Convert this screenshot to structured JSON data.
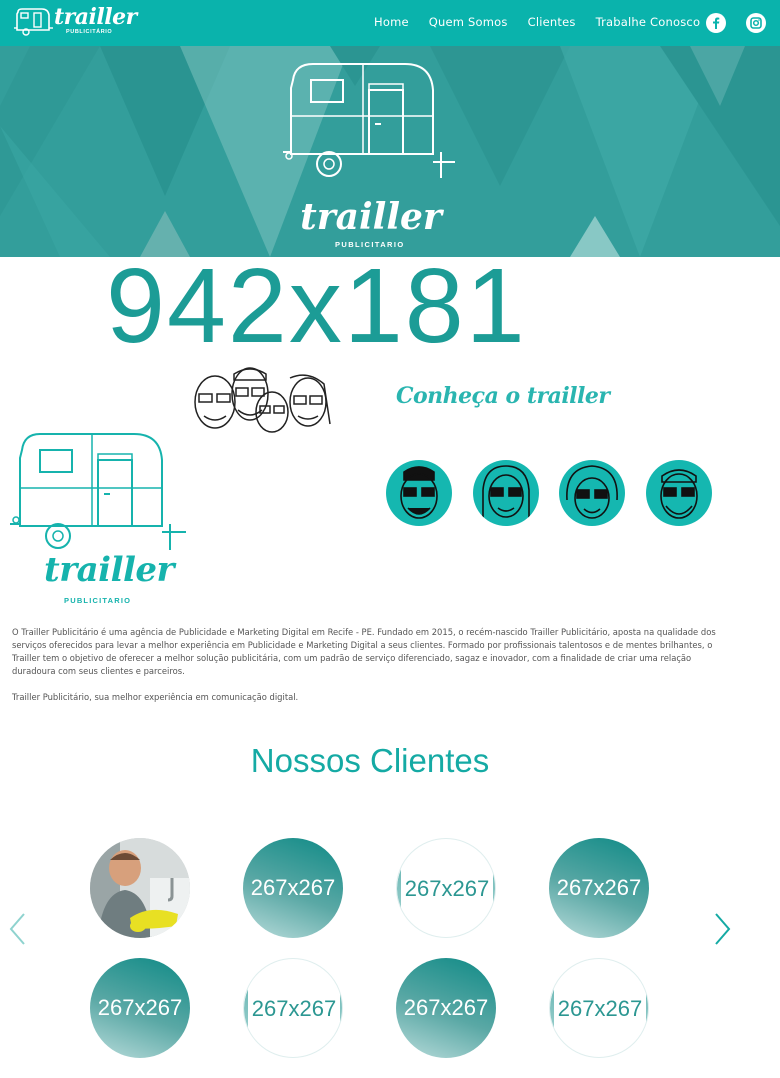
{
  "nav": {
    "brand": "trailler",
    "brand_sub": "PUBLICITÁRIO",
    "links": [
      "Home",
      "Quem Somos",
      "Clientes",
      "Trabalhe Conosco"
    ],
    "social": [
      "facebook-icon",
      "instagram-icon"
    ]
  },
  "hero": {
    "logo_word": "trailler",
    "logo_sub": "PUBLICITARIO"
  },
  "banner_placeholder": "942x181",
  "team": {
    "heading": "Conheça o trailler",
    "avatars": [
      "team-member-1",
      "team-member-2",
      "team-member-3",
      "team-member-4"
    ]
  },
  "big_logo": {
    "word": "trailler",
    "sub": "PUBLICITARIO"
  },
  "about": {
    "paragraph1": "O Trailler Publicitário é uma agência de Publicidade e Marketing Digital em Recife - PE. Fundado em 2015, o recém-nascido Trailler Publicitário, aposta na qualidade dos serviços oferecidos para levar a melhor experiência em Publicidade e Marketing Digital a seus clientes. Formado por profissionais talentosos e de mentes brilhantes, o Trailler tem o objetivo de oferecer a melhor solução publicitária, com um padrão de serviço diferenciado, sagaz e inovador, com a finalidade de criar uma relação duradoura com seus clientes e parceiros.",
    "paragraph2": "Trailler Publicitário, sua melhor experiência em comunicação digital."
  },
  "clients": {
    "title": "Nossos Clientes",
    "items": [
      "",
      "267x267",
      "267x267",
      "267x267",
      "267x267",
      "267x267",
      "267x267",
      "267x267"
    ]
  },
  "colors": {
    "brand": "#0ab3ac",
    "hero_bg": "#339e9b",
    "accent_text": "#15aaa4"
  }
}
